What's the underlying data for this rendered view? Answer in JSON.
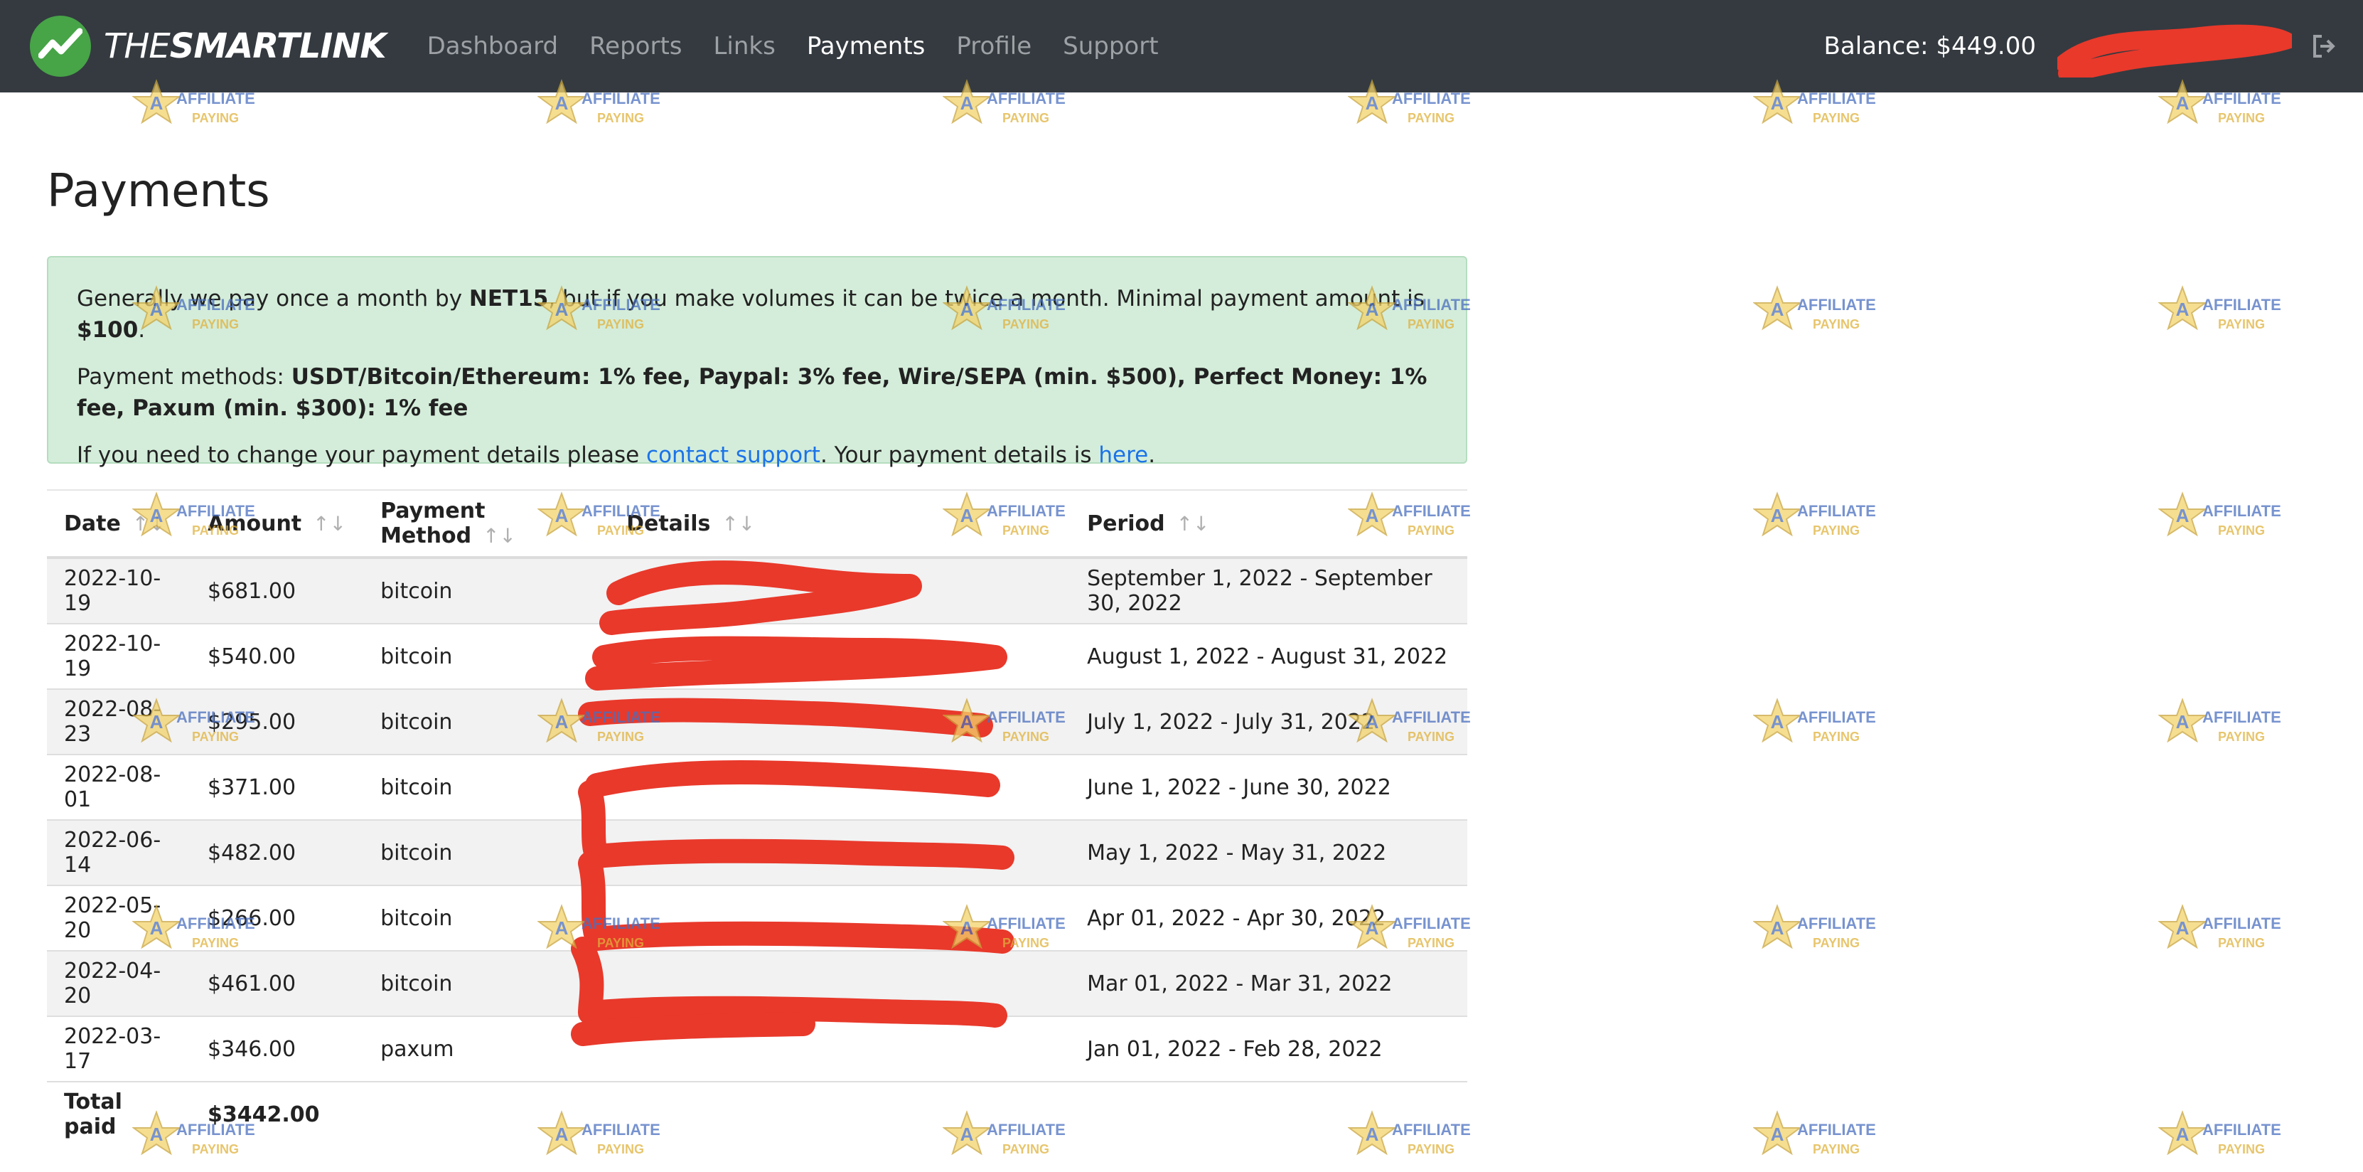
{
  "brand": {
    "prefix": "THE",
    "bold": "SMARTLINK"
  },
  "nav": {
    "links": [
      "Dashboard",
      "Reports",
      "Links",
      "Payments",
      "Profile",
      "Support"
    ],
    "active": "Payments",
    "balance": "Balance: $449.00"
  },
  "page": {
    "title": "Payments"
  },
  "alert": {
    "line1": {
      "text_a": "Generally we pay once a month by ",
      "bold_a": "NET15",
      "text_b": ", but if you make volumes it can be twice a month. Minimal payment amount is ",
      "bold_b": "$100",
      "text_c": "."
    },
    "line2": {
      "label": "Payment methods: ",
      "methods": "USDT/Bitcoin/Ethereum: 1% fee, Paypal: 3% fee, Wire/SEPA (min. $500), Perfect Money: 1% fee, Paxum (min. $300): 1% fee"
    },
    "line3": {
      "text_a": "If you need to change your payment details please ",
      "link_a": "contact support",
      "text_b": ". Your payment details is ",
      "link_b": "here",
      "text_c": "."
    }
  },
  "table": {
    "headers": [
      "Date",
      "Amount",
      "Payment Method",
      "Details",
      "Period"
    ],
    "sort_glyph": "↑↓",
    "rows": [
      {
        "date": "2022-10-19",
        "amount": "$681.00",
        "method": "bitcoin",
        "details": "",
        "period": "September 1, 2022 - September 30, 2022"
      },
      {
        "date": "2022-10-19",
        "amount": "$540.00",
        "method": "bitcoin",
        "details": "",
        "period": "August 1, 2022 - August 31, 2022"
      },
      {
        "date": "2022-08-23",
        "amount": "$295.00",
        "method": "bitcoin",
        "details": "",
        "period": "July 1, 2022 - July 31, 2022"
      },
      {
        "date": "2022-08-01",
        "amount": "$371.00",
        "method": "bitcoin",
        "details": "",
        "period": "June 1, 2022 - June 30, 2022"
      },
      {
        "date": "2022-06-14",
        "amount": "$482.00",
        "method": "bitcoin",
        "details": "",
        "period": "May 1, 2022 - May 31, 2022"
      },
      {
        "date": "2022-05-20",
        "amount": "$266.00",
        "method": "bitcoin",
        "details": "",
        "period": "Apr 01, 2022 - Apr 30, 2022"
      },
      {
        "date": "2022-04-20",
        "amount": "$461.00",
        "method": "bitcoin",
        "details": "",
        "period": "Mar 01, 2022 - Mar 31, 2022"
      },
      {
        "date": "2022-03-17",
        "amount": "$346.00",
        "method": "paxum",
        "details": "",
        "period": "Jan 01, 2022 - Feb 28, 2022"
      }
    ],
    "total_label": "Total paid",
    "total_value": "$3442.00"
  },
  "watermark": {
    "text": "AFFILIATE PAYING"
  },
  "colors": {
    "navbar": "#343a40",
    "alert_bg": "#d4edda",
    "link": "#1a73e8",
    "redaction": "#e8392b",
    "brand_green": "#47a447"
  }
}
